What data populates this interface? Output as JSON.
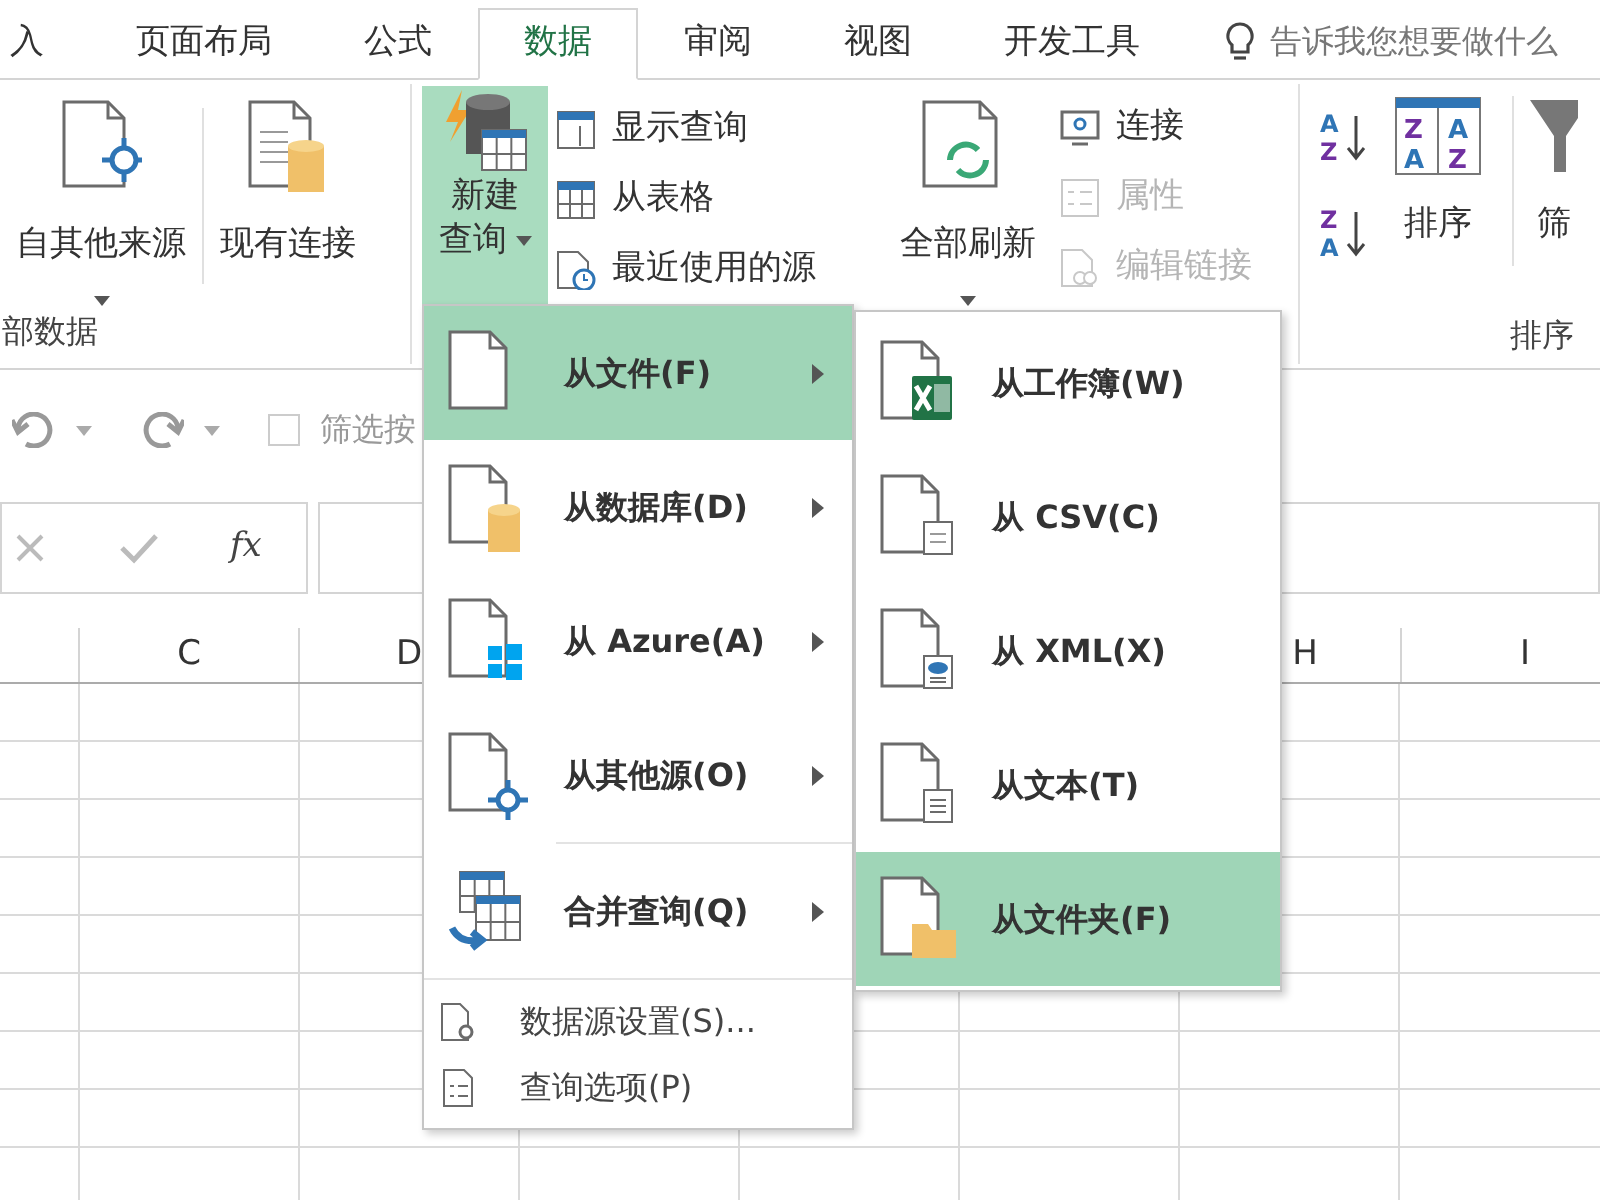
{
  "tabs": [
    {
      "label": "入",
      "selected": false
    },
    {
      "label": "页面布局",
      "selected": false
    },
    {
      "label": "公式",
      "selected": false
    },
    {
      "label": "数据",
      "selected": true
    },
    {
      "label": "审阅",
      "selected": false
    },
    {
      "label": "视图",
      "selected": false
    },
    {
      "label": "开发工具",
      "selected": false
    }
  ],
  "tell_me": {
    "placeholder": "告诉我您想要做什么"
  },
  "get_data": {
    "label": "部数据",
    "buttons": [
      {
        "label": "自其他来源",
        "kind": "other",
        "dropdown": true
      },
      {
        "label": "现有连接",
        "kind": "existing",
        "dropdown": false
      }
    ]
  },
  "query": {
    "new_query": {
      "lines": [
        "新建",
        "查询"
      ],
      "active": true,
      "dropdown": true
    },
    "small": [
      {
        "label": "显示查询",
        "kind": "show",
        "disabled": false
      },
      {
        "label": "从表格",
        "kind": "table",
        "disabled": false
      },
      {
        "label": "最近使用的源",
        "kind": "recent",
        "disabled": false
      }
    ]
  },
  "connections": {
    "refresh_all": {
      "label": "全部刷新",
      "dropdown": true
    },
    "small": [
      {
        "label": "连接",
        "kind": "connect",
        "disabled": false
      },
      {
        "label": "属性",
        "kind": "props",
        "disabled": true
      },
      {
        "label": "编辑链接",
        "kind": "links",
        "disabled": true
      }
    ]
  },
  "sort": {
    "label": "排序",
    "sort_button": "排序",
    "filter_button": "筛",
    "asc_letters": [
      "A",
      "Z"
    ],
    "desc_letters": [
      "Z",
      "A"
    ],
    "dialog_letters": [
      "Z",
      "A",
      "A",
      "Z"
    ]
  },
  "quick_access": {
    "filter_checkbox": {
      "label": "筛选按",
      "checked": false
    }
  },
  "formula_bar": {
    "fx": "fx"
  },
  "sheet": {
    "left_columns": [
      "C",
      "D"
    ],
    "right_columns": [
      "H",
      "I"
    ]
  },
  "query_menu": {
    "items": [
      {
        "label": "从文件(F)",
        "kind": "file",
        "selected": true
      },
      {
        "label": "从数据库(D)",
        "kind": "database",
        "selected": false
      },
      {
        "label": "从 Azure(A)",
        "kind": "azure",
        "selected": false
      },
      {
        "label": "从其他源(O)",
        "kind": "other",
        "selected": false
      },
      {
        "label": "合并查询(Q)",
        "kind": "merge",
        "selected": false
      }
    ],
    "footer": [
      {
        "label": "数据源设置(S)...",
        "kind": "settings"
      },
      {
        "label": "查询选项(P)",
        "kind": "options"
      }
    ]
  },
  "file_menu": {
    "items": [
      {
        "label": "从工作簿(W)",
        "kind": "workbook",
        "selected": false
      },
      {
        "label": "从 CSV(C)",
        "kind": "csv",
        "selected": false
      },
      {
        "label": "从 XML(X)",
        "kind": "xml",
        "selected": false
      },
      {
        "label": "从文本(T)",
        "kind": "text",
        "selected": false
      },
      {
        "label": "从文件夹(F)",
        "kind": "folder",
        "selected": true
      }
    ]
  }
}
